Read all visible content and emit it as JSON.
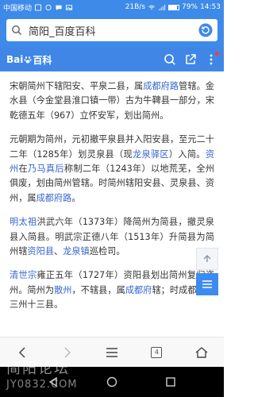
{
  "status": {
    "carrier": "中国移动",
    "network_speed": "21B/s",
    "battery_pct": "79%",
    "time": "14:53"
  },
  "url_bar": {
    "text": "简阳_百度百科"
  },
  "header": {
    "logo_text": "Bai",
    "logo_suffix": "百科"
  },
  "article": {
    "p1": [
      {
        "t": "宋朝简州下辖阳安、平泉二县，属",
        "link": false
      },
      {
        "t": "成都府路",
        "link": true
      },
      {
        "t": "管辖。金水县（今金堂县淮口镇一带）古为牛鞞县一部分，宋乾德五年（967）立怀安军，划出简州。",
        "link": false
      }
    ],
    "p2": [
      {
        "t": "元朝期为简州，元初撤平泉县并入阳安县，至元二十二年（1285年）划灵泉县（现",
        "link": false
      },
      {
        "t": "龙泉驿区",
        "link": true
      },
      {
        "t": "）入简。",
        "link": false
      },
      {
        "t": "资州",
        "link": true
      },
      {
        "t": "在",
        "link": false
      },
      {
        "t": "乃马真后",
        "link": true
      },
      {
        "t": "称制二年（1243年）以地荒芜，全州俱废，划由简州管辖。时简州辖阳安县、灵泉县、资州，属",
        "link": false
      },
      {
        "t": "成都府路",
        "link": true
      },
      {
        "t": "。",
        "link": false
      }
    ],
    "p3": [
      {
        "t": "明太祖",
        "link": true
      },
      {
        "t": "洪武六年（1373年）降简州为简县，撤灵泉县入简县。明武宗正德八年（1513年）升简县为简州辖",
        "link": false
      },
      {
        "t": "资阳县",
        "link": true
      },
      {
        "t": "、",
        "link": false
      },
      {
        "t": "龙泉镇",
        "link": true
      },
      {
        "t": "巡检司。",
        "link": false
      }
    ],
    "p4": [
      {
        "t": "清世宗",
        "link": true
      },
      {
        "t": "雍正五年（1727年）资阳县划出简州复归资州。简州为",
        "link": false
      },
      {
        "t": "散州",
        "link": true
      },
      {
        "t": "，不辖县，属",
        "link": false
      },
      {
        "t": "成都府",
        "link": true
      },
      {
        "t": "辖；时成都府领三州十三县。",
        "link": false
      }
    ]
  },
  "toolbar": {
    "tab_count": "4"
  },
  "watermark": {
    "main": "简阳论坛",
    "sub": "JY0832.COM"
  },
  "colors": {
    "accent": "#3e8ae8",
    "link": "#3366cc"
  }
}
